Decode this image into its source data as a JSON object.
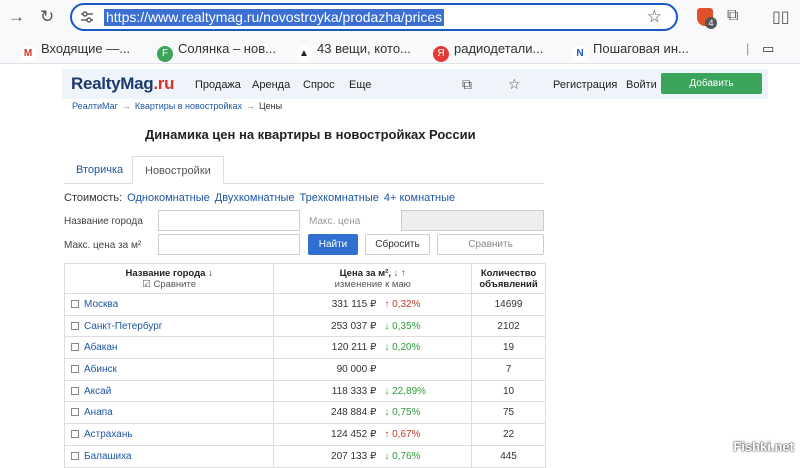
{
  "browser": {
    "url": "https://www.realtymag.ru/novostroyka/prodazha/prices",
    "extension_badge": "4",
    "bookmarks": [
      {
        "label": "Входящие —...",
        "icon": "gmail-icon",
        "color": "#d93025",
        "glyph": "M"
      },
      {
        "label": "Солянка – нов...",
        "icon": "f-circle-icon",
        "color": "#3ba55c",
        "glyph": "F"
      },
      {
        "label": "43 вещи, кото...",
        "icon": "tux-icon",
        "color": "#222222",
        "glyph": "🐧"
      },
      {
        "label": "радиодетали...",
        "icon": "yandex-icon",
        "color": "#e53935",
        "glyph": "Я"
      },
      {
        "label": "Пошаговая ин...",
        "icon": "nt-icon",
        "color": "#1a57c7",
        "glyph": "N"
      }
    ]
  },
  "site": {
    "logo_main": "RealtyMag",
    "logo_suffix": ".ru",
    "menu": [
      "Продажа",
      "Аренда",
      "Спрос",
      "Еще"
    ],
    "register": "Регистрация",
    "login": "Войти",
    "add_button": "Добавить объявление",
    "breadcrumbs": [
      "РеалтиМаг",
      "Квартиры в новостройках",
      "Цены"
    ],
    "page_title": "Динамика цен на квартиры в новостройках России",
    "tabs": [
      "Вторичка",
      "Новостройки"
    ],
    "cost_label": "Стоимость:",
    "cost_links": [
      "Однокомнатные",
      "Двухкомнатные",
      "Трехкомнатные",
      "4+ комнатные"
    ],
    "filters": {
      "city_label": "Название города",
      "max_price_placeholder": "Макс. цена",
      "max_price_sqm_label": "Макс. цена за м²",
      "find_button": "Найти",
      "reset_button": "Сбросить",
      "compare_button": "Сравнить"
    },
    "table": {
      "col_city": "Название города",
      "col_city_sort": "↓",
      "col_city_sub": "Сравните",
      "col_price": "Цена за м²,",
      "col_price_sort": "↓ ↑",
      "col_price_sub": "изменение к маю",
      "col_count_line1": "Количество",
      "col_count_line2": "объявлений",
      "rows": [
        {
          "city": "Москва",
          "price": "331 115 ₽",
          "change": "↑ 0,32%",
          "dir": "up",
          "count": "14699"
        },
        {
          "city": "Санкт-Петербург",
          "price": "253 037 ₽",
          "change": "↓ 0,35%",
          "dir": "down",
          "count": "2102"
        },
        {
          "city": "Абакан",
          "price": "120 211 ₽",
          "change": "↓ 0,20%",
          "dir": "down",
          "count": "19"
        },
        {
          "city": "Абинск",
          "price": "90 000 ₽",
          "change": "",
          "dir": "none",
          "count": "7"
        },
        {
          "city": "Аксай",
          "price": "118 333 ₽",
          "change": "↓ 22,89%",
          "dir": "down",
          "count": "10"
        },
        {
          "city": "Анапа",
          "price": "248 884 ₽",
          "change": "↓ 0,75%",
          "dir": "down",
          "count": "75"
        },
        {
          "city": "Астрахань",
          "price": "124 452 ₽",
          "change": "↑ 0,67%",
          "dir": "up",
          "count": "22"
        },
        {
          "city": "Балашиха",
          "price": "207 133 ₽",
          "change": "↓ 0,76%",
          "dir": "down",
          "count": "445"
        }
      ]
    }
  },
  "watermark": "Fishki.net"
}
